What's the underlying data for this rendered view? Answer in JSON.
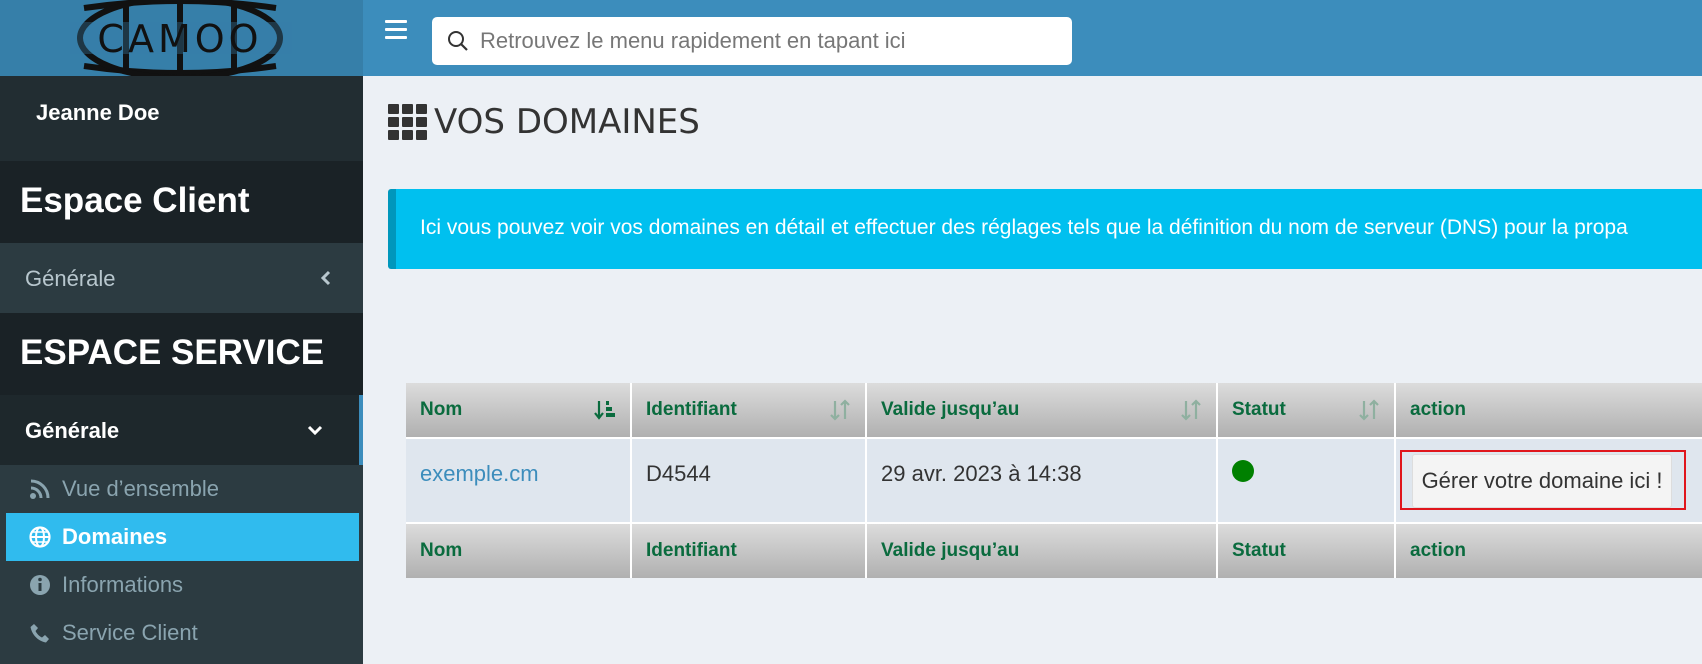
{
  "brand": {
    "logo_text": "CAMOO"
  },
  "user": {
    "name": "Jeanne Doe"
  },
  "sidebar": {
    "espace_client": {
      "heading": "Espace Client",
      "items": [
        {
          "label": "Générale",
          "expanded": false
        }
      ]
    },
    "espace_service": {
      "heading": "ESPACE SERVICE",
      "group": {
        "label": "Générale",
        "expanded": true
      },
      "items": [
        {
          "label": "Vue d’ensemble",
          "icon": "rss-icon",
          "active": false
        },
        {
          "label": "Domaines",
          "icon": "globe-icon",
          "active": true
        },
        {
          "label": "Informations",
          "icon": "info-circle-icon",
          "active": false
        },
        {
          "label": "Service Client",
          "icon": "phone-icon",
          "active": false
        }
      ]
    }
  },
  "header": {
    "menu_icon": "hamburger-icon",
    "search": {
      "placeholder": "Retrouvez le menu rapidement en tapant ici",
      "value": ""
    }
  },
  "page": {
    "title": "VOS DOMAINES",
    "title_icon": "grid-icon",
    "callout_text": "Ici vous pouvez voir vos domaines en détail et effectuer des réglages tels que la définition du nom de serveur (DNS) pour la propa"
  },
  "table": {
    "columns": [
      "Nom",
      "Identifiant",
      "Valide jusqu’au",
      "Statut",
      "action"
    ],
    "rows": [
      {
        "nom": "exemple.cm",
        "identifiant": "D4544",
        "valide": "29 avr. 2023 à 14:38",
        "statut": "active",
        "action_label": "Gérer votre domaine ici !"
      }
    ]
  },
  "colors": {
    "header_blue": "#3c8dbc",
    "sidebar_dark": "#222d32",
    "active_item": "#30bbee",
    "callout": "#00c0ef",
    "column_header_text": "#0a6b3e",
    "status_ok": "#008000",
    "highlight_border": "#e0161c"
  }
}
